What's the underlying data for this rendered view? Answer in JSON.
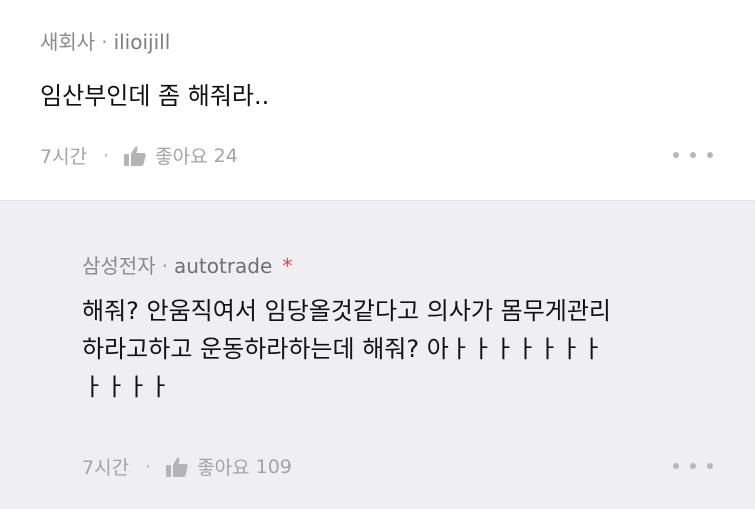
{
  "comments": [
    {
      "company": "새회사",
      "separator": "·",
      "username": "ilioijill",
      "text": "임산부인데 좀 해줘라..",
      "time": "7시간",
      "footer_separator": "·",
      "like_label": "좋아요",
      "likes": "24",
      "icons": [
        "thumbs-up-icon",
        "more-icon"
      ]
    },
    {
      "company": "삼성전자",
      "separator": "·",
      "username": "autotrade",
      "author_marker": "*",
      "text_lines": [
        "해줘? 안움직여서 임당올것같다고 의사가 몸무게관리",
        "하라고하고 운동하라하는데 해줘? 아ㅏㅏㅏㅏㅏㅏㅏ",
        "ㅏㅏㅏㅏ"
      ],
      "time": "7시간",
      "footer_separator": "·",
      "like_label": "좋아요",
      "likes": "109",
      "icons": [
        "thumbs-up-icon",
        "more-icon"
      ]
    }
  ],
  "colors": {
    "reply_background": "#efeff3",
    "author_marker": "#ff3b30",
    "meta_text": "#8a8a8f",
    "body_text": "#111111"
  }
}
